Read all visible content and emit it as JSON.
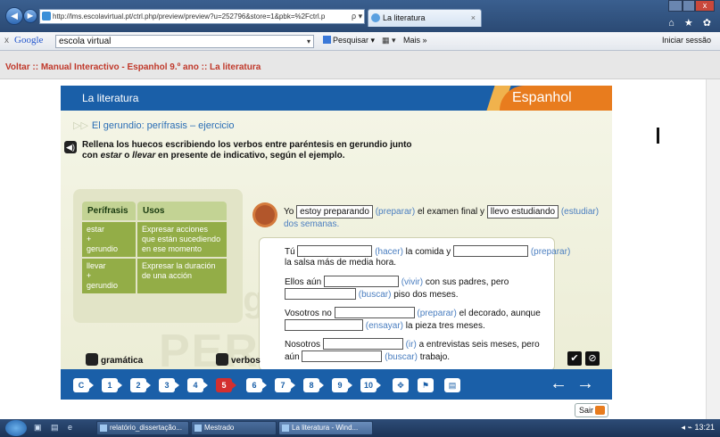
{
  "browser": {
    "url": "http://lms.escolavirtual.pt/ctrl.php/preview/preview?u=252796&store=1&pbk=%2Fctrl.p",
    "addr_controls": "ρ ▾ C ✕",
    "tab_title": "La literatura",
    "tab_close": "×",
    "back": "◄",
    "forward": "►",
    "close_label": "x",
    "fav_icons": "⌂ ★ ✿"
  },
  "google_toolbar": {
    "close": "x",
    "logo": "Google",
    "search_value": "escola virtual",
    "search_dropdown": "▾",
    "pesquisar": "Pesquisar ▾",
    "more1": "▦ ▾",
    "mais": "Mais »",
    "signin": "Iniciar sessão"
  },
  "breadcrumb": "Voltar :: Manual Interactivo - Espanhol 9.º ano :: La literatura",
  "book": {
    "section_title": "La literatura",
    "brand": "Espanhol",
    "exercise_arrow": "▷▷",
    "exercise_title": "El gerundio: perífrasis – ejercicio",
    "speaker": "◀)",
    "instructions_line1": "Rellena los huecos escribiendo los verbos entre paréntesis en gerundio junto",
    "instructions_line2_pre": "con ",
    "instructions_estar": "estar",
    "instructions_o": " o ",
    "instructions_llevar": "llevar",
    "instructions_line2_post": " en presente de indicativo, según el ejemplo.",
    "watermark_1": "Erg",
    "watermark_2": "PERÍFRA",
    "table": {
      "headers": [
        "Perífrasis",
        "Usos"
      ],
      "rows": [
        {
          "perifrasis": [
            "estar",
            "+",
            "gerundio"
          ],
          "usos": "Expresar acciones que están sucediendo en ese momento"
        },
        {
          "perifrasis": [
            "llevar",
            "+",
            "gerundio"
          ],
          "usos": "Expresar la duración de una acción"
        }
      ]
    },
    "example": {
      "p1": "Yo ",
      "f1": "estoy preparando",
      "h1": " (preparar)",
      "p2": " el examen final y ",
      "f2": "llevo estudiando",
      "h2": " (estudiar)",
      "p3": " dos semanas."
    },
    "exercise": {
      "l1_a": "Tú ",
      "l1_h1": " (hacer)",
      "l1_b": " la comida y ",
      "l1_h2": " (preparar)",
      "l2": "la salsa más de media hora.",
      "l3_a": "Ellos aún ",
      "l3_h": " (vivir)",
      "l3_b": " con sus padres, pero",
      "l4_h": " (buscar)",
      "l4_b": " piso dos meses.",
      "l5_a": "Vosotros no ",
      "l5_h": " (preparar)",
      "l5_b": " el decorado, aunque",
      "l6_h": " (ensayar)",
      "l6_b": " la pieza tres meses.",
      "l7_a": "Nosotros ",
      "l7_h": " (ir)",
      "l7_b": " a entrevistas seis meses, pero",
      "l8_a": "aún ",
      "l8_h": " (buscar)",
      "l8_b": " trabajo."
    },
    "gramatica": "gramática",
    "verbos": "verbos",
    "check": "✔",
    "reset": "⊘",
    "nav": {
      "pages": [
        "C",
        "1",
        "2",
        "3",
        "4",
        "5",
        "6",
        "7",
        "8",
        "9",
        "10"
      ],
      "active_page": "5",
      "tools": [
        "✥",
        "⚑",
        "▤"
      ],
      "prev": "←",
      "next": "→"
    },
    "sair": "Sair"
  },
  "taskbar": {
    "quick_launch": "▣ ▤ e",
    "task1": "relatório_dissertação...",
    "task2": "Mestrado",
    "task3": "La literatura - Wind...",
    "tray": "◂ ⌁ 13:21"
  },
  "colors": {
    "brand_blue": "#1a5fa8",
    "brand_orange": "#e87c1e",
    "table_header": "#c3d394",
    "table_cell": "#93ad47",
    "active_page": "#d32f2f",
    "breadcrumb_red": "#c0392b"
  }
}
